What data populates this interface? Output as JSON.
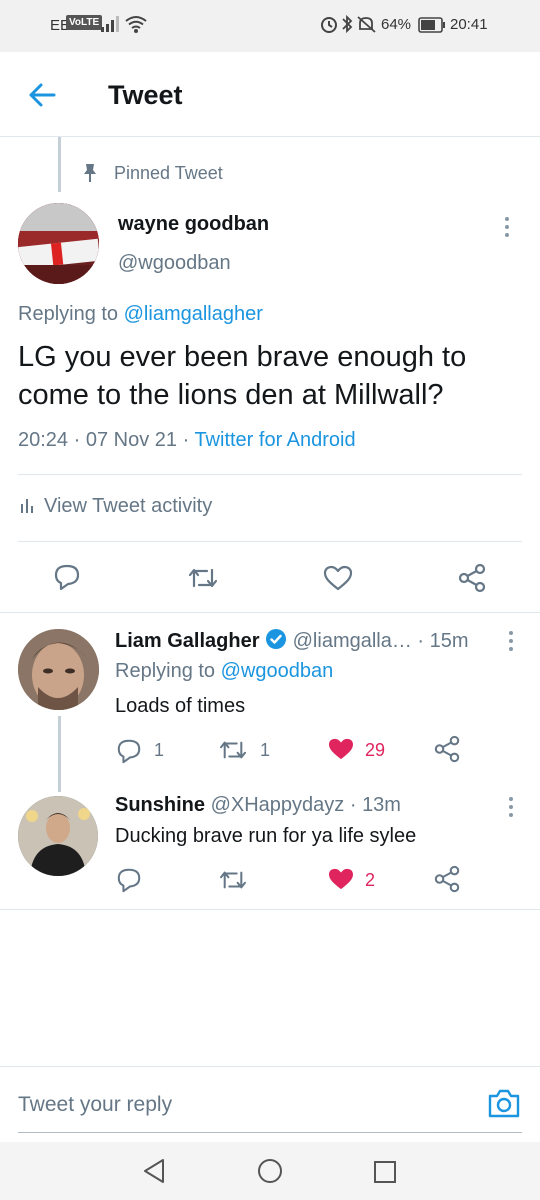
{
  "status_bar": {
    "carrier": "EE",
    "volte": "VoLTE",
    "battery_pct": "64%",
    "time": "20:41"
  },
  "header": {
    "title": "Tweet"
  },
  "tweet": {
    "pinned_label": "Pinned Tweet",
    "name": "wayne goodban",
    "handle": "@wgoodban",
    "replying_prefix": "Replying to",
    "replying_to": "@liamgallagher",
    "text": "LG you ever been brave enough to come to the lions den at Millwall?",
    "time": "20:24",
    "date": "07 Nov 21",
    "source": "Twitter for Android",
    "activity_label": "View Tweet activity"
  },
  "replies": [
    {
      "name": "Liam Gallagher",
      "handle": "@liamgalla…",
      "age": "15m",
      "replying_prefix": "Replying to",
      "replying_to": "@wgoodban",
      "text": "Loads of times",
      "reply_count": "1",
      "retweet_count": "1",
      "like_count": "29",
      "verified": true
    },
    {
      "name": "Sunshine",
      "handle": "@XHappydayz",
      "age": "13m",
      "text": "Ducking brave run for ya life sylee",
      "reply_count": "",
      "retweet_count": "",
      "like_count": "2"
    }
  ],
  "compose": {
    "placeholder": "Tweet your reply"
  },
  "colors": {
    "accent": "#1b95e0",
    "like": "#e0245e",
    "muted": "#657786"
  }
}
